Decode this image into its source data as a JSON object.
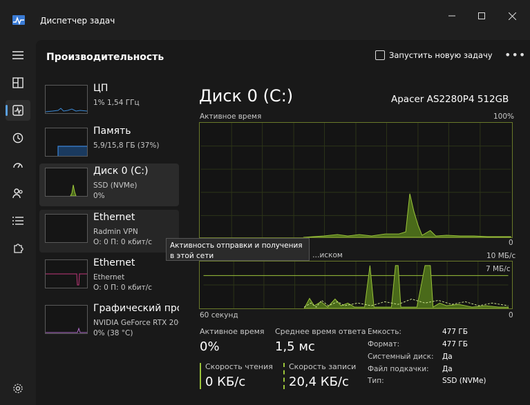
{
  "window": {
    "title": "Диспетчер задач",
    "controls": [
      "minimize-icon",
      "maximize-icon",
      "close-icon"
    ]
  },
  "nav": {
    "items": [
      {
        "icon": "hamburger-icon"
      },
      {
        "icon": "processes-icon"
      },
      {
        "icon": "performance-icon",
        "selected": true
      },
      {
        "icon": "history-icon"
      },
      {
        "icon": "startup-icon"
      },
      {
        "icon": "users-icon"
      },
      {
        "icon": "details-icon"
      },
      {
        "icon": "services-icon"
      }
    ],
    "settings_icon": "gear-icon"
  },
  "header": {
    "title": "Производительность",
    "run_task": "Запустить новую задачу",
    "more": "•••"
  },
  "devices": [
    {
      "name": "ЦП",
      "line1": "1%  1,54 ГГц",
      "line2": ""
    },
    {
      "name": "Память",
      "line1": "5,9/15,8 ГБ (37%)",
      "line2": ""
    },
    {
      "name": "Диск 0 (C:)",
      "line1": "SSD (NVMe)",
      "line2": "0%"
    },
    {
      "name": "Ethernet",
      "line1": "Radmin VPN",
      "line2": "О: 0 П: 0 кбит/с"
    },
    {
      "name": "Ethernet",
      "line1": "Ethernet",
      "line2": "О: 0 П: 0 кбит/с"
    },
    {
      "name": "Графический про",
      "line1": "NVIDIA GeForce RTX 206",
      "line2": "0%  (38 °C)"
    }
  ],
  "tooltip": "Активность отправки и получения в этой сети",
  "detail": {
    "title": "Диск 0 (C:)",
    "model": "Apacer AS2280P4 512GB",
    "graph1": {
      "label": "Активное время",
      "max": "100%",
      "min": "0"
    },
    "graph2": {
      "label": "…иском",
      "max": "10 МБ/с",
      "ref": "7 МБ/с",
      "min": "0",
      "time": "60 секунд"
    },
    "stats": {
      "active_label": "Активное время",
      "active_value": "0%",
      "resp_label": "Среднее время ответа",
      "resp_value": "1,5 мс",
      "read_label": "Скорость чтения",
      "read_value": "0 КБ/с",
      "write_label": "Скорость записи",
      "write_value": "20,4 КБ/с"
    },
    "info": [
      {
        "k": "Емкость:",
        "v": "477 ГБ"
      },
      {
        "k": "Формат:",
        "v": "477 ГБ"
      },
      {
        "k": "Системный диск:",
        "v": "Да"
      },
      {
        "k": "Файл подкачки:",
        "v": "Да"
      },
      {
        "k": "Тип:",
        "v": "SSD (NVMe)"
      }
    ]
  },
  "colors": {
    "accent": "#5aa0e0",
    "disk": "#9cc53a",
    "network": "#c1377a",
    "gpu": "#b06cc9",
    "memory": "#3c84d6"
  }
}
